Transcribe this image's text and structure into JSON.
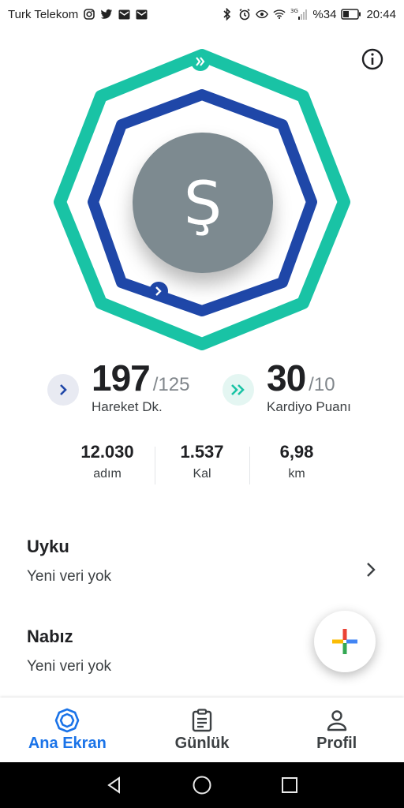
{
  "status_bar": {
    "carrier": "Turk Telekom",
    "network_type": "3G",
    "battery": "%34",
    "time": "20:44"
  },
  "avatar": {
    "initial": "Ş"
  },
  "goals": {
    "move_minutes": {
      "value": "197",
      "target": "/125",
      "label": "Hareket Dk.",
      "progress": 1.576
    },
    "heart_points": {
      "value": "30",
      "target": "/10",
      "label": "Kardiyo Puanı",
      "progress": 3.0
    }
  },
  "metrics": [
    {
      "value": "12.030",
      "label": "adım"
    },
    {
      "value": "1.537",
      "label": "Kal"
    },
    {
      "value": "6,98",
      "label": "km"
    }
  ],
  "cards": {
    "sleep": {
      "title": "Uyku",
      "subtitle": "Yeni veri yok"
    },
    "heart_rate": {
      "title": "Nabız",
      "subtitle": "Yeni veri yok"
    }
  },
  "bottom_nav": {
    "home": "Ana Ekran",
    "journal": "Günlük",
    "profile": "Profil",
    "active": "home"
  },
  "colors": {
    "heart_ring": "#19c3a5",
    "move_ring": "#1f47a8",
    "active_tab": "#1a73e8",
    "avatar_bg": "#7d8a90"
  }
}
